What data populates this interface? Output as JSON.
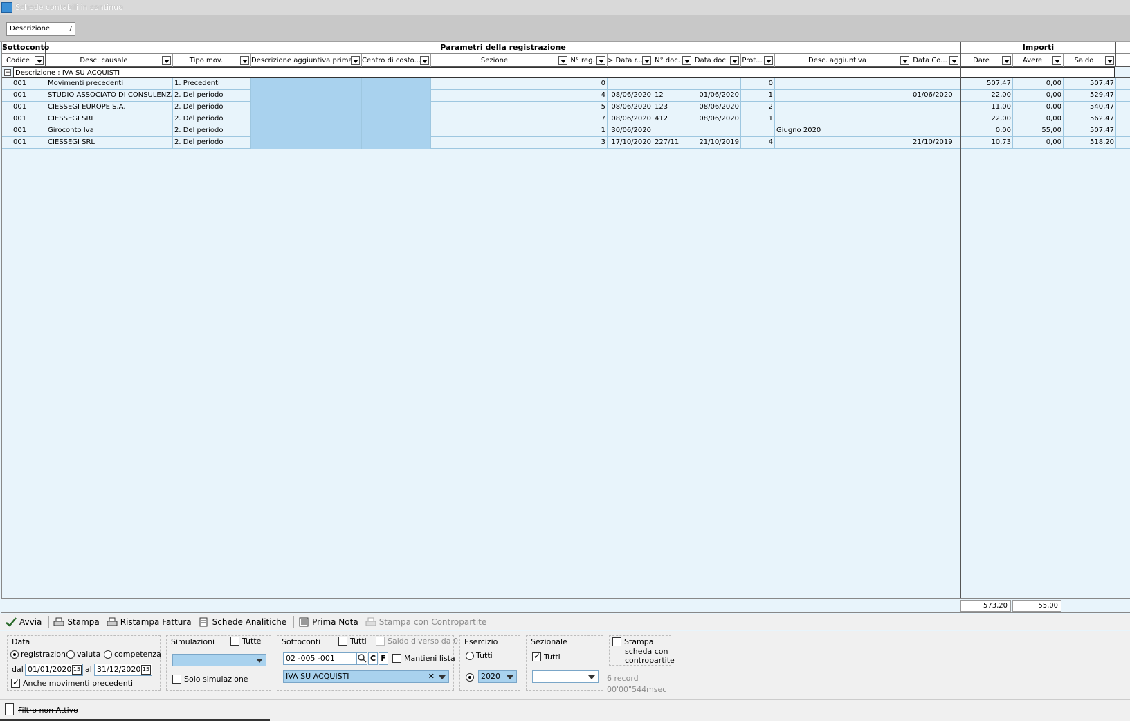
{
  "window": {
    "title": "Schede contabili in continuo"
  },
  "groupby": {
    "label": "Descrizione",
    "sort": "/"
  },
  "bands": {
    "sottoconto": "Sottoconto",
    "parametri": "Parametri della registrazione",
    "importi": "Importi"
  },
  "columns": {
    "codice": "Codice",
    "desc_causale": "Desc. causale",
    "tipo_mov": "Tipo mov.",
    "desc_agg_prima": "Descrizione aggiuntiva prima...",
    "centro_costo": "Centro di costo...",
    "sezione": "Sezione",
    "n_reg": "N° reg.",
    "data_r": "> Data r...",
    "n_doc": "N° doc.",
    "data_doc": "Data doc.",
    "prot": "Prot...",
    "desc_agg": "Desc. aggiuntiva",
    "data_co": "Data Co...",
    "dare": "Dare",
    "avere": "Avere",
    "saldo": "Saldo"
  },
  "group": {
    "toggle": "−",
    "label": "Descrizione : IVA SU ACQUISTI"
  },
  "rows": [
    {
      "codice": "001",
      "desc_causale": "Movimenti precedenti",
      "tipo_mov": "1. Precedenti",
      "n_reg": "0",
      "data_r": "",
      "n_doc": "",
      "data_doc": "",
      "prot": "0",
      "desc_agg": "",
      "data_co": "",
      "dare": "507,47",
      "avere": "0,00",
      "saldo": "507,47"
    },
    {
      "codice": "001",
      "desc_causale": "STUDIO ASSOCIATO DI CONSULENZA",
      "tipo_mov": "2. Del periodo",
      "n_reg": "4",
      "data_r": "08/06/2020",
      "n_doc": "12",
      "data_doc": "01/06/2020",
      "prot": "1",
      "desc_agg": "",
      "data_co": "01/06/2020",
      "dare": "22,00",
      "avere": "0,00",
      "saldo": "529,47"
    },
    {
      "codice": "001",
      "desc_causale": "CIESSEGI EUROPE S.A.",
      "tipo_mov": "2. Del periodo",
      "n_reg": "5",
      "data_r": "08/06/2020",
      "n_doc": "123",
      "data_doc": "08/06/2020",
      "prot": "2",
      "desc_agg": "",
      "data_co": "",
      "dare": "11,00",
      "avere": "0,00",
      "saldo": "540,47"
    },
    {
      "codice": "001",
      "desc_causale": "CIESSEGI SRL",
      "tipo_mov": "2. Del periodo",
      "n_reg": "7",
      "data_r": "08/06/2020",
      "n_doc": "412",
      "data_doc": "08/06/2020",
      "prot": "1",
      "desc_agg": "",
      "data_co": "",
      "dare": "22,00",
      "avere": "0,00",
      "saldo": "562,47"
    },
    {
      "codice": "001",
      "desc_causale": "Giroconto Iva",
      "tipo_mov": "2. Del periodo",
      "n_reg": "1",
      "data_r": "30/06/2020",
      "n_doc": "",
      "data_doc": "",
      "prot": "",
      "desc_agg": "Giugno 2020",
      "data_co": "",
      "dare": "0,00",
      "avere": "55,00",
      "saldo": "507,47"
    },
    {
      "codice": "001",
      "desc_causale": "CIESSEGI SRL",
      "tipo_mov": "2. Del periodo",
      "n_reg": "3",
      "data_r": "17/10/2020",
      "n_doc": "227/11",
      "data_doc": "21/10/2019",
      "prot": "4",
      "desc_agg": "",
      "data_co": "21/10/2019",
      "dare": "10,73",
      "avere": "0,00",
      "saldo": "518,20"
    }
  ],
  "totals": {
    "dare": "573,20",
    "avere": "55,00"
  },
  "toolbar": {
    "avvia": "Avvia",
    "stampa": "Stampa",
    "ristampa": "Ristampa Fattura",
    "schede": "Schede Analitiche",
    "prima_nota": "Prima Nota",
    "contropartite": "Stampa con Contropartite"
  },
  "filters": {
    "data": {
      "legend": "Data",
      "registrazione": "registrazione",
      "valuta": "valuta",
      "competenza": "competenza",
      "dal": "dal",
      "al": "al",
      "from": "01/01/2020",
      "to": "31/12/2020",
      "anche": "Anche movimenti precedenti",
      "cal_icon": "15"
    },
    "simulazioni": {
      "legend": "Simulazioni",
      "tutte": "Tutte",
      "solo": "Solo simulazione"
    },
    "sottoconti": {
      "legend": "Sottoconti",
      "tutti": "Tutti",
      "saldo": "Saldo diverso da 0",
      "code": "02    -005     -001",
      "btn_c": "C",
      "btn_f": "F",
      "mantieni": "Mantieni lista",
      "selected": "IVA SU ACQUISTI",
      "clear": "✕"
    },
    "esercizio": {
      "legend": "Esercizio",
      "tutti": "Tutti",
      "year": "2020"
    },
    "sezionale": {
      "legend": "Sezionale",
      "tutti": "Tutti"
    },
    "stampa_scheda": {
      "l1": "Stampa",
      "l2": "scheda con",
      "l3": "contropartite"
    },
    "info": {
      "records": "6 record",
      "time": "00'00\"544msec"
    }
  },
  "status": {
    "filter": "Filtro non Attivo"
  }
}
